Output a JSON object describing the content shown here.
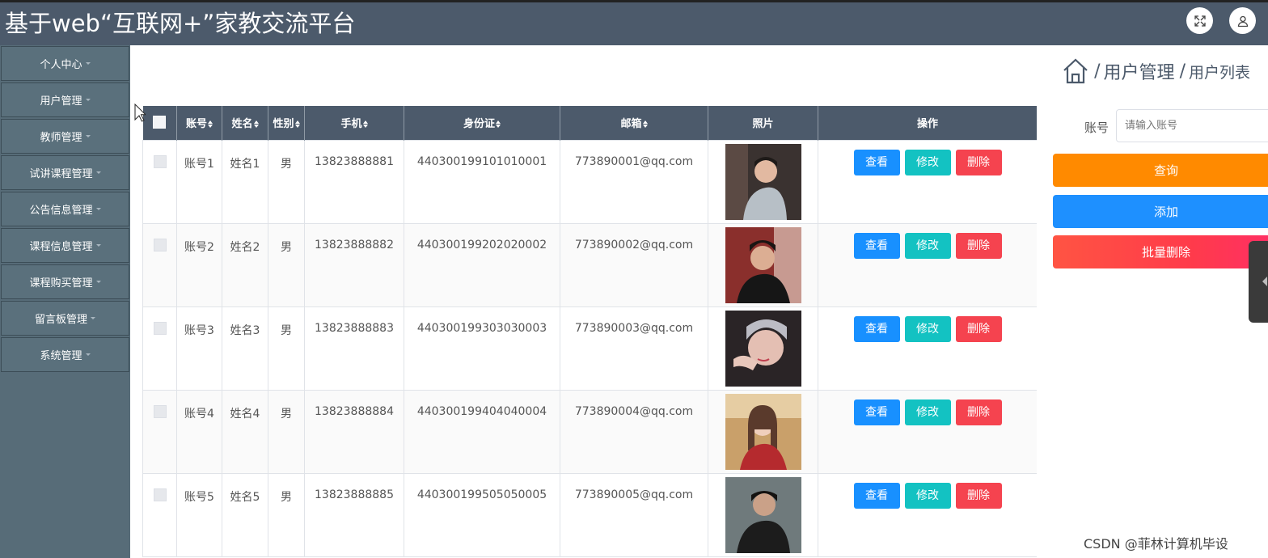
{
  "header": {
    "title": "基于web“互联网+”家教交流平台",
    "fullscreen_icon": "expand-arrows-icon",
    "user_icon": "user-icon",
    "bg_color": "#4c5a6b"
  },
  "sidebar": {
    "items": [
      {
        "label": "个人中心"
      },
      {
        "label": "用户管理"
      },
      {
        "label": "教师管理"
      },
      {
        "label": "试讲课程管理"
      },
      {
        "label": "公告信息管理"
      },
      {
        "label": "课程信息管理"
      },
      {
        "label": "课程购买管理"
      },
      {
        "label": "留言板管理"
      },
      {
        "label": "系统管理"
      }
    ]
  },
  "breadcrumb": {
    "home_icon": "home-icon",
    "items": [
      "用户管理",
      "用户列表"
    ]
  },
  "table": {
    "columns": [
      "账号",
      "姓名",
      "性别",
      "手机",
      "身份证",
      "邮箱",
      "照片",
      "操作"
    ],
    "sortable": [
      true,
      true,
      true,
      true,
      true,
      true,
      false,
      false
    ],
    "rows": [
      {
        "account": "账号1",
        "name": "姓名1",
        "gender": "男",
        "phone": "13823888881",
        "id_card": "440300199101010001",
        "email": "773890001@qq.com"
      },
      {
        "account": "账号2",
        "name": "姓名2",
        "gender": "男",
        "phone": "13823888882",
        "id_card": "440300199202020002",
        "email": "773890002@qq.com"
      },
      {
        "account": "账号3",
        "name": "姓名3",
        "gender": "男",
        "phone": "13823888883",
        "id_card": "440300199303030003",
        "email": "773890003@qq.com"
      },
      {
        "account": "账号4",
        "name": "姓名4",
        "gender": "男",
        "phone": "13823888884",
        "id_card": "440300199404040004",
        "email": "773890004@qq.com"
      },
      {
        "account": "账号5",
        "name": "姓名5",
        "gender": "男",
        "phone": "13823888885",
        "id_card": "440300199505050005",
        "email": "773890005@qq.com"
      }
    ],
    "actions": {
      "view": "查看",
      "edit": "修改",
      "delete": "删除"
    }
  },
  "search": {
    "label": "账号",
    "placeholder": "请输入账号",
    "query_button": "查询",
    "add_button": "添加",
    "batch_delete_button": "批量删除"
  },
  "colors": {
    "query": "#ff8a00",
    "add": "#1e90ff",
    "batch_delete": "#ff3b4a",
    "view": "#1890ff",
    "edit": "#13c2c2",
    "delete": "#f5434f"
  },
  "watermark": "CSDN @菲林计算机毕设"
}
